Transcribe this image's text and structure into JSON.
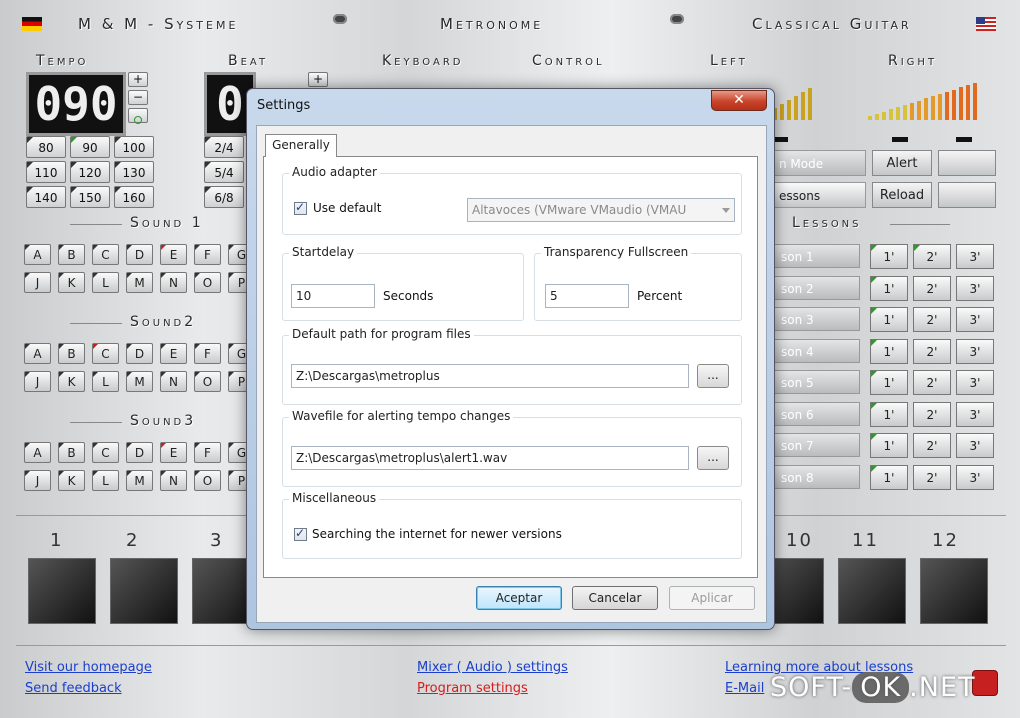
{
  "header": {
    "vendor": "M & M - Systeme",
    "center_title": "Metronome",
    "right_title": "Classical Guitar",
    "left_flag": "german-flag-icon",
    "right_flag": "us-flag-icon"
  },
  "sections": {
    "tempo": "Tempo",
    "beat": "Beat",
    "keyboard": "Keyboard",
    "control": "Control",
    "left": "Left",
    "right": "Right",
    "sound1": "Sound 1",
    "sound2": "Sound2",
    "sound3": "Sound3",
    "lessons": "Lessons"
  },
  "tempo": {
    "display": "090",
    "plus": "+",
    "minus": "−",
    "presets": [
      "80",
      "90",
      "100",
      "110",
      "120",
      "130",
      "140",
      "150",
      "160"
    ]
  },
  "beat": {
    "display": "0",
    "plus": "+",
    "presets": [
      "2/4",
      "5/4",
      "6/8"
    ]
  },
  "keys": {
    "row1": [
      "A",
      "B",
      "C",
      "D",
      "E",
      "F",
      "G"
    ],
    "row2": [
      "J",
      "K",
      "L",
      "M",
      "N",
      "O",
      "P"
    ]
  },
  "control_buttons": {
    "alert": "Alert",
    "reload": "Reload",
    "mode_partial": "n Mode",
    "lessons_partial": "essons"
  },
  "lessons": {
    "items": [
      "son 1",
      "son 2",
      "son 3",
      "son 4",
      "son 5",
      "son 6",
      "son 7",
      "son 8"
    ],
    "options": [
      "1'",
      "2'",
      "3'"
    ]
  },
  "pads": {
    "numbers": [
      "1",
      "2",
      "3",
      "10",
      "11",
      "12"
    ]
  },
  "footer_links": {
    "homepage": "Visit our homepage",
    "feedback": "Send feedback",
    "mixer": "Mixer ( Audio ) settings",
    "program_settings": "Program settings",
    "learn": "Learning more about lessons",
    "email": "E-Mail"
  },
  "watermark": {
    "pre": "SOFT-",
    "ok": "OK",
    "post": ".NET"
  },
  "dialog": {
    "title": "Settings",
    "close": "✕",
    "tab": "Generally",
    "audio": {
      "legend": "Audio adapter",
      "use_default_label": "Use default",
      "use_default_checked": true,
      "device": "Altavoces (VMware VMaudio (VMAU"
    },
    "startdelay": {
      "legend": "Startdelay",
      "value": "10",
      "unit": "Seconds"
    },
    "transparency": {
      "legend": "Transparency Fullscreen",
      "value": "5",
      "unit": "Percent"
    },
    "default_path": {
      "legend": "Default path for program files",
      "value": "Z:\\Descargas\\metroplus",
      "browse": "..."
    },
    "wavefile": {
      "legend": "Wavefile for alerting tempo changes",
      "value": "Z:\\Descargas\\metroplus\\alert1.wav",
      "browse": "..."
    },
    "misc": {
      "legend": "Miscellaneous",
      "search_label": "Searching the internet for newer versions",
      "search_checked": true
    },
    "buttons": {
      "ok": "Aceptar",
      "cancel": "Cancelar",
      "apply": "Aplicar"
    }
  }
}
